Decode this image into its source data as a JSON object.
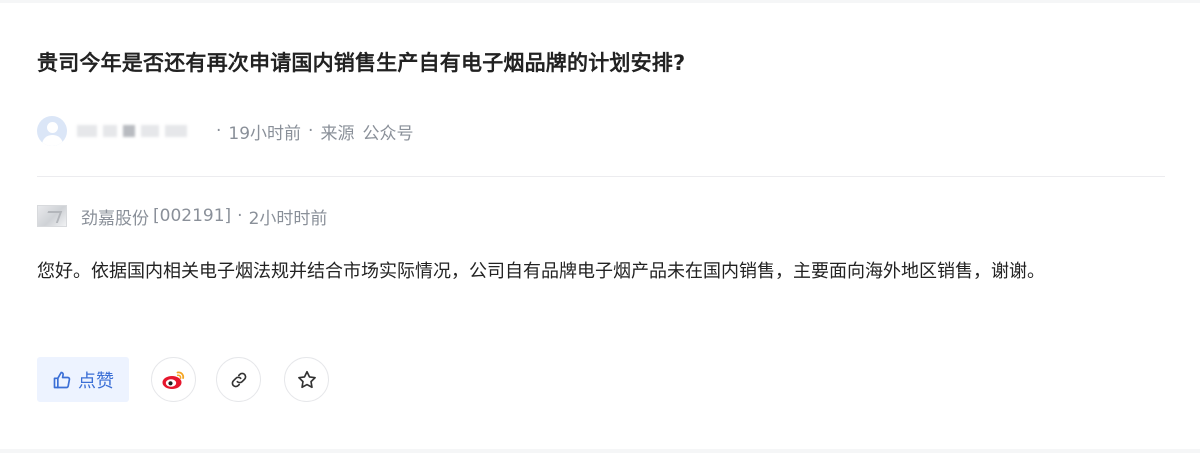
{
  "question": {
    "title": "贵司今年是否还有再次申请国内销售生产自有电子烟品牌的计划安排?",
    "time": "19小时前",
    "source_label": "来源",
    "source": "公众号",
    "separator": "·"
  },
  "answer": {
    "company_name": "劲嘉股份",
    "stock_code": "[002191]",
    "time": "2小时时前",
    "separator": "·",
    "text": "您好。依据国内相关电子烟法规并结合市场实际情况，公司自有品牌电子烟产品未在国内销售，主要面向海外地区销售，谢谢。"
  },
  "actions": {
    "like_label": "点赞"
  },
  "icons": {
    "like": "thumbs-up-icon",
    "weibo": "weibo-icon",
    "link": "link-icon",
    "star": "star-icon",
    "avatar": "user-avatar-icon",
    "company_logo": "company-logo-icon"
  },
  "colors": {
    "accent": "#3b6fd6",
    "weibo_red": "#e6162d",
    "weibo_orange": "#f5a623"
  }
}
